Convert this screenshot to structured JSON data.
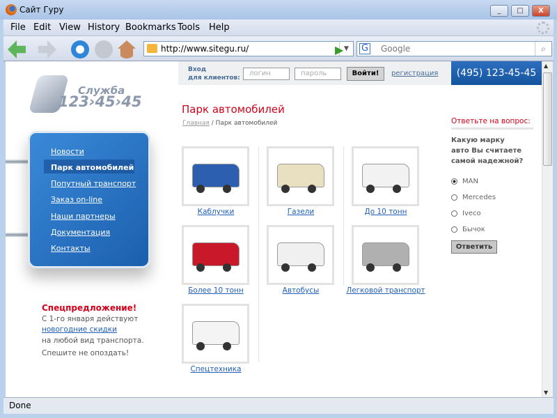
{
  "window": {
    "title": "Сайт Гуру",
    "controls": [
      "_",
      "□",
      "X"
    ]
  },
  "menu": [
    "File",
    "Edit",
    "View",
    "History",
    "Bookmarks",
    "Tools",
    "Help"
  ],
  "toolbar": {
    "url": "http://www.sitegu.ru/",
    "search_placeholder": "Google"
  },
  "status": "Done",
  "header": {
    "login_label_1": "Вход",
    "login_label_2": "для клиентов:",
    "login_placeholder": "логин",
    "password_placeholder": "пароль",
    "login_button": "Войти!",
    "register": "регистрация",
    "phone": "(495) 123-45-45"
  },
  "logo": {
    "line1": "Служба",
    "line2": "123›45›45"
  },
  "sidebar": {
    "items": [
      "Новости",
      "Парк автомобилей",
      "Попутный транспорт",
      "Заказ on-line",
      "Наши партнеры",
      "Документация",
      "Контакты"
    ],
    "active": 1
  },
  "promo": {
    "title": "Спецпредложение!",
    "line1": "С 1-го января действуют",
    "link": "новогодние скидки",
    "line2": "на любой вид транспорта.",
    "line3": "Спешите не опоздать!"
  },
  "main": {
    "title": "Парк автомобилей",
    "breadcrumb_home": "Главная",
    "breadcrumb_sep": "/",
    "breadcrumb_current": "Парк автомобилей",
    "vehicles": [
      {
        "label": "Каблучки",
        "icon": "van-icon"
      },
      {
        "label": "Газели",
        "icon": "light-truck-icon"
      },
      {
        "label": "До 10 тонн",
        "icon": "box-truck-icon"
      },
      {
        "label": "Более 10 тонн",
        "icon": "semi-truck-icon"
      },
      {
        "label": "Автобусы",
        "icon": "bus-icon"
      },
      {
        "label": "Легковой транспорт",
        "icon": "car-icon"
      },
      {
        "label": "Спецтехника",
        "icon": "crane-truck-icon"
      }
    ]
  },
  "poll": {
    "title": "Ответьте на вопрос:",
    "question": [
      "Какую марку",
      "авто Вы считаете",
      "самой надежной?"
    ],
    "options": [
      "MAN",
      "Mercedes",
      "Iveco",
      "Бычок"
    ],
    "selected": 0,
    "button": "Ответить"
  },
  "colors": {
    "accent_red": "#d4001a",
    "nav_blue": "#1b5fae",
    "link": "#1f5fb8"
  }
}
